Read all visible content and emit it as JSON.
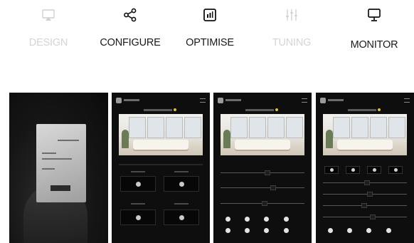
{
  "nav": {
    "items": [
      {
        "key": "design",
        "label": "DESIGN",
        "icon": "cast-icon",
        "active": false
      },
      {
        "key": "configure",
        "label": "CONFIGURE",
        "icon": "share-nodes-icon",
        "active": true
      },
      {
        "key": "optimise",
        "label": "OPTIMISE",
        "icon": "bar-chart-square-icon",
        "active": true
      },
      {
        "key": "tuning",
        "label": "TUNING",
        "icon": "sliders-icon",
        "active": false
      },
      {
        "key": "monitor",
        "label": "MONITOR",
        "icon": "monitor-icon",
        "active": true
      }
    ]
  },
  "colors": {
    "active_text": "#1a1a1a",
    "inactive_text": "#d4d4d4",
    "phone_background": "#0e0e0e",
    "zone_indicator": "#e0c04a"
  },
  "screens": [
    {
      "name": "photo-of-hand-holding-card",
      "icon": "photo"
    },
    {
      "name": "app-screen-configure"
    },
    {
      "name": "app-screen-tuning"
    },
    {
      "name": "app-screen-monitor"
    }
  ]
}
